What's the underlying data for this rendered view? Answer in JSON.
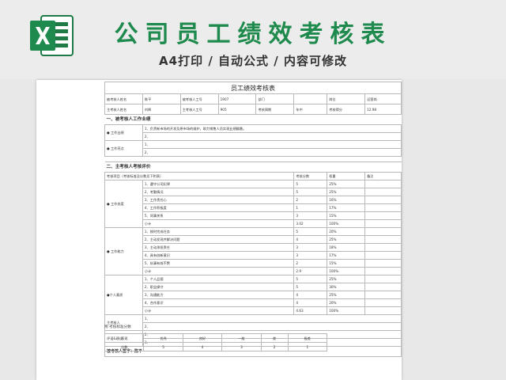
{
  "banner": {
    "title": "公司员工绩效考核表",
    "subtitle": "A4打印 / 自动公式 / 内容可修改"
  },
  "sheet": {
    "title": "员工绩效考核表",
    "info1": [
      "被考核人姓名",
      "陈平",
      "被考核人工号",
      "1907",
      "部门",
      "岗位",
      "运营岗"
    ],
    "info2": [
      "主考核人姓名",
      "刘辉",
      "主考核人工号",
      "905",
      "考核周期",
      "年中",
      "考核得分",
      "12.98"
    ],
    "section1": "一、被考核人工作业绩",
    "perf": [
      {
        "label": "● 工作业绩",
        "lines": [
          "1、负责新市场的开发及原市场的维护，助力销售人员实现业绩翻番。",
          "2、"
        ]
      },
      {
        "label": "● 工作亮点",
        "lines": [
          "1、",
          "2、"
        ]
      }
    ],
    "section2": "二、主考核人考核评价",
    "header": [
      "考核项目（考核标准及分数见下附表）",
      "考核分数",
      "权重",
      "备注"
    ],
    "groups": [
      {
        "label": "● 工作态度",
        "items": [
          [
            "1、遵守公司纪律",
            "5",
            "25%"
          ],
          [
            "2、考勤情况",
            "5",
            "25%"
          ],
          [
            "3、工作责任心",
            "2",
            "16%"
          ],
          [
            "4、工作积极度",
            "1",
            "17%"
          ],
          [
            "5、同事关系",
            "3",
            "15%"
          ]
        ],
        "subtotal": [
          "小计",
          "3.02",
          "100%"
        ]
      },
      {
        "label": "● 工作能力",
        "items": [
          [
            "1、按时完成任务",
            "5",
            "20%"
          ],
          [
            "2、主动发现并解决问题",
            "4",
            "25%"
          ],
          [
            "3、主动承担责任",
            "3",
            "18%"
          ],
          [
            "4、具有创新意识",
            "3",
            "17%"
          ],
          [
            "5、执事有效不赘",
            "2",
            "15%"
          ]
        ],
        "subtotal": [
          "小计",
          "2.9",
          "100%"
        ]
      },
      {
        "label": "●个人素质",
        "items": [
          [
            "1、个人品德",
            "5",
            "25%"
          ],
          [
            "2、职业操守",
            "5",
            "30%"
          ],
          [
            "3、沟通能力",
            "4",
            "25%"
          ],
          [
            "4、合作意识",
            "4",
            "20%"
          ]
        ],
        "subtotal": [
          "小计",
          "4.63",
          "100%"
        ]
      }
    ],
    "remarks": [
      {
        "label": "主考核人",
        "lines": [
          "1、",
          "2、"
        ]
      },
      {
        "label": "评语&建议",
        "lines": [
          "2、",
          "3、"
        ]
      }
    ],
    "signature": "被考核人签字：陈平",
    "note": "附:考核标准分数",
    "score_table": {
      "header": [
        "表现",
        "优秀",
        "良好",
        "一般",
        "差",
        "极差"
      ],
      "row": [
        "分数",
        "5",
        "4",
        "3",
        "2",
        "1"
      ]
    }
  },
  "colors": {
    "brand_green": "#1f8a4d",
    "link_blue": "#3b5bb5"
  }
}
